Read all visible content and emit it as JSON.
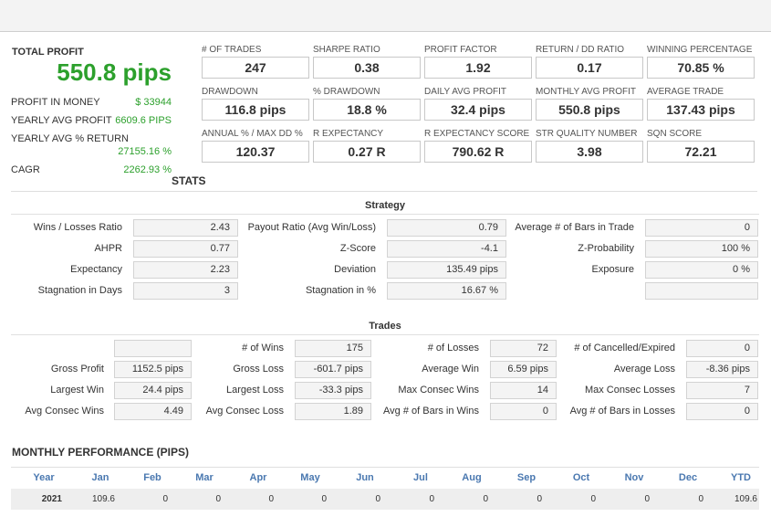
{
  "profit": {
    "title": "TOTAL PROFIT",
    "value": "550.8 pips",
    "rows": [
      {
        "label": "PROFIT IN MONEY",
        "value": "$ 33944"
      },
      {
        "label": "YEARLY AVG PROFIT",
        "value": "6609.6 PIPS"
      },
      {
        "label": "YEARLY AVG % RETURN",
        "value": "27155.16 %"
      },
      {
        "label": "CAGR",
        "value": "2262.93 %"
      }
    ]
  },
  "metrics": [
    {
      "label": "# OF TRADES",
      "value": "247"
    },
    {
      "label": "SHARPE RATIO",
      "value": "0.38"
    },
    {
      "label": "PROFIT FACTOR",
      "value": "1.92"
    },
    {
      "label": "RETURN / DD RATIO",
      "value": "0.17"
    },
    {
      "label": "WINNING PERCENTAGE",
      "value": "70.85 %"
    },
    {
      "label": "DRAWDOWN",
      "value": "116.8 pips"
    },
    {
      "label": "% DRAWDOWN",
      "value": "18.8 %"
    },
    {
      "label": "DAILY AVG PROFIT",
      "value": "32.4 pips"
    },
    {
      "label": "MONTHLY AVG PROFIT",
      "value": "550.8 pips"
    },
    {
      "label": "AVERAGE TRADE",
      "value": "137.43 pips"
    },
    {
      "label": "ANNUAL % / MAX DD %",
      "value": "120.37"
    },
    {
      "label": "R EXPECTANCY",
      "value": "0.27 R"
    },
    {
      "label": "R EXPECTANCY SCORE",
      "value": "790.62 R"
    },
    {
      "label": "STR QUALITY NUMBER",
      "value": "3.98"
    },
    {
      "label": "SQN SCORE",
      "value": "72.21"
    }
  ],
  "stats_title": "STATS",
  "strategy": {
    "title": "Strategy",
    "rows": [
      [
        {
          "label": "Wins / Losses Ratio",
          "value": "2.43"
        },
        {
          "label": "Payout Ratio (Avg Win/Loss)",
          "value": "0.79"
        },
        {
          "label": "Average # of Bars in Trade",
          "value": "0"
        }
      ],
      [
        {
          "label": "AHPR",
          "value": "0.77"
        },
        {
          "label": "Z-Score",
          "value": "-4.1"
        },
        {
          "label": "Z-Probability",
          "value": "100 %"
        }
      ],
      [
        {
          "label": "Expectancy",
          "value": "2.23"
        },
        {
          "label": "Deviation",
          "value": "135.49 pips"
        },
        {
          "label": "Exposure",
          "value": "0 %"
        }
      ],
      [
        {
          "label": "Stagnation in Days",
          "value": "3"
        },
        {
          "label": "Stagnation in %",
          "value": "16.67 %"
        },
        {
          "label": "",
          "value": ""
        }
      ]
    ]
  },
  "trades": {
    "title": "Trades",
    "rows": [
      [
        {
          "label": "",
          "value": ""
        },
        {
          "label": "# of Wins",
          "value": "175"
        },
        {
          "label": "# of Losses",
          "value": "72"
        },
        {
          "label": "# of Cancelled/Expired",
          "value": "0"
        }
      ],
      [
        {
          "label": "Gross Profit",
          "value": "1152.5 pips"
        },
        {
          "label": "Gross Loss",
          "value": "-601.7 pips"
        },
        {
          "label": "Average Win",
          "value": "6.59 pips"
        },
        {
          "label": "Average Loss",
          "value": "-8.36 pips"
        }
      ],
      [
        {
          "label": "Largest Win",
          "value": "24.4 pips"
        },
        {
          "label": "Largest Loss",
          "value": "-33.3 pips"
        },
        {
          "label": "Max Consec Wins",
          "value": "14"
        },
        {
          "label": "Max Consec Losses",
          "value": "7"
        }
      ],
      [
        {
          "label": "Avg Consec Wins",
          "value": "4.49"
        },
        {
          "label": "Avg Consec Loss",
          "value": "1.89"
        },
        {
          "label": "Avg # of Bars in Wins",
          "value": "0"
        },
        {
          "label": "Avg # of Bars in Losses",
          "value": "0"
        }
      ]
    ]
  },
  "monthly": {
    "title": "MONTHLY PERFORMANCE (PIPS)",
    "headers": [
      "Year",
      "Jan",
      "Feb",
      "Mar",
      "Apr",
      "May",
      "Jun",
      "Jul",
      "Aug",
      "Sep",
      "Oct",
      "Nov",
      "Dec",
      "YTD"
    ],
    "row": [
      "2021",
      "109.6",
      "0",
      "0",
      "0",
      "0",
      "0",
      "0",
      "0",
      "0",
      "0",
      "0",
      "0",
      "109.6"
    ]
  },
  "colors": {
    "profit_green": "#2ca02c",
    "header_blue": "#4a78b0"
  }
}
